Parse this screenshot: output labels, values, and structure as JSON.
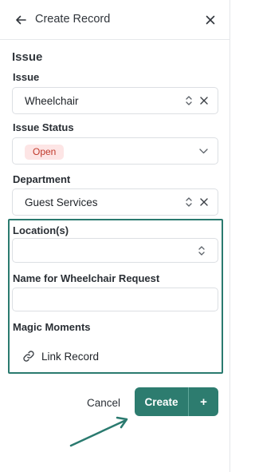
{
  "header": {
    "title": "Create Record",
    "back_icon": "arrow-left-icon",
    "close_icon": "close-icon"
  },
  "section": {
    "title": "Issue"
  },
  "fields": {
    "issue": {
      "label": "Issue",
      "value": "Wheelchair"
    },
    "issue_status": {
      "label": "Issue Status",
      "value": "Open"
    },
    "department": {
      "label": "Department",
      "value": "Guest Services"
    },
    "locations": {
      "label": "Location(s)",
      "value": ""
    },
    "name_for_request": {
      "label": "Name for Wheelchair Request",
      "value": ""
    },
    "magic_moments": {
      "label": "Magic Moments",
      "link_label": "Link Record"
    }
  },
  "footer": {
    "cancel_label": "Cancel",
    "create_label": "Create",
    "create_more_label": "+"
  },
  "colors": {
    "accent": "#2d7c6f",
    "highlight_border": "#2a7a6f",
    "status_open_bg": "#fde5e5",
    "status_open_text": "#c0392b"
  }
}
